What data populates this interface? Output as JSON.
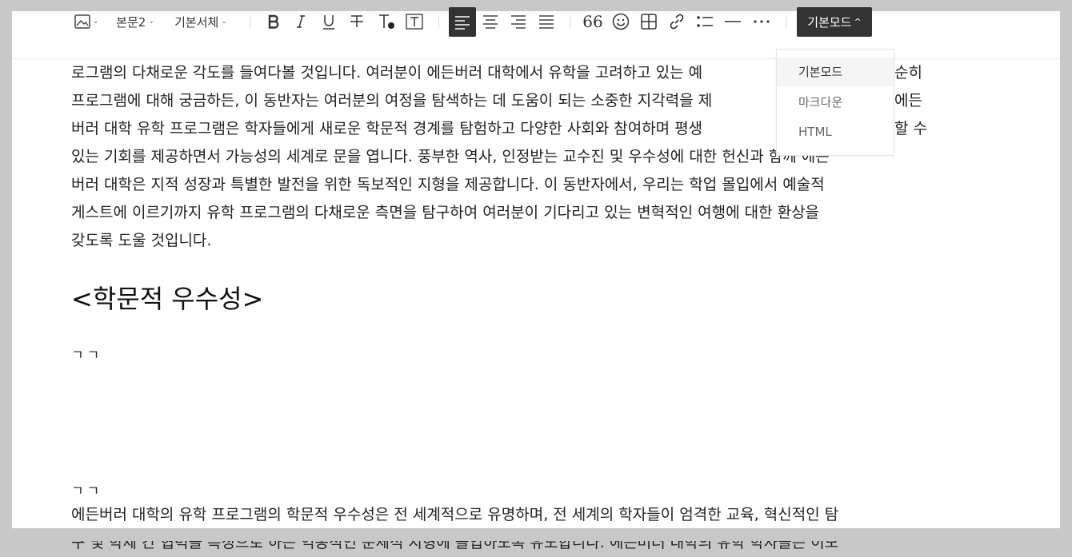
{
  "toolbar": {
    "paragraph_style": "본문2",
    "font_family": "기본서체",
    "mode_label": "기본모드",
    "mode_caret": "^"
  },
  "mode_menu": {
    "items": [
      {
        "label": "기본모드",
        "selected": true
      },
      {
        "label": "마크다운",
        "selected": false
      },
      {
        "label": "HTML",
        "selected": false
      }
    ]
  },
  "content": {
    "intro_lines": [
      "로그램의 다채로운 각도를 들여다볼 것입니다. 여러분이 에든버러 대학에서 유학을 고려하고 있는 예",
      "프로그램에 대해 궁금하든, 이 동반자는 여러분의 여정을 탐색하는 데 도움이 되는 소중한 지각력을 제",
      "버러 대학 유학 프로그램은 학자들에게 새로운 학문적 경계를 탐험하고 다양한 사회와 참여하며 평생",
      "있는 기회를 제공하면서 가능성의 세계로 문을 엽니다. 풍부한 역사, 인정받는 교수진 및 우수성에 대한 헌신과 함께 에든",
      "버러 대학은 지적 성장과 특별한 발전을 위한 독보적인 지형을 제공합니다. 이 동반자에서, 우리는 학업 몰입에서 예술적",
      "게스트에 이르기까지 유학 프로그램의 다채로운 측면을 탐구하여 여러분이 기다리고 있는 변혁적인 여행에 대한 환상을",
      "갖도록 도울 것입니다."
    ],
    "intro_line1_tail": "순히",
    "intro_line2_tail": "에든",
    "intro_line3_tail": "할 수",
    "heading": "<학문적 우수성>",
    "jamo_1": "ㄱㄱ",
    "jamo_2": "ㄱㄱ",
    "body_lines": [
      "에든버러 대학의 유학 프로그램의 학문적 우수성은 전 세계적으로 유명하며, 전 세계의 학자들이 엄격한 교육, 혁신적인 탐",
      "구 및 학제 간 협력을 특징으로 하는 역동적인 문체적 지형에 몰입하도록 유도합니다. 에든버러 대학의 유학 학자들은 이모"
    ]
  },
  "colors": {
    "active_bg": "#333333",
    "page_bg": "#ffffff",
    "outer_bg": "#c8c8c8"
  },
  "icons": [
    "image-icon",
    "bold-icon",
    "italic-icon",
    "underline-icon",
    "strikethrough-icon",
    "text-color-icon",
    "text-background-icon",
    "align-left-icon",
    "align-center-icon",
    "align-right-icon",
    "align-justify-icon",
    "quote-icon",
    "emoji-icon",
    "table-icon",
    "link-icon",
    "list-icon",
    "horizontal-rule-icon",
    "more-icon"
  ]
}
